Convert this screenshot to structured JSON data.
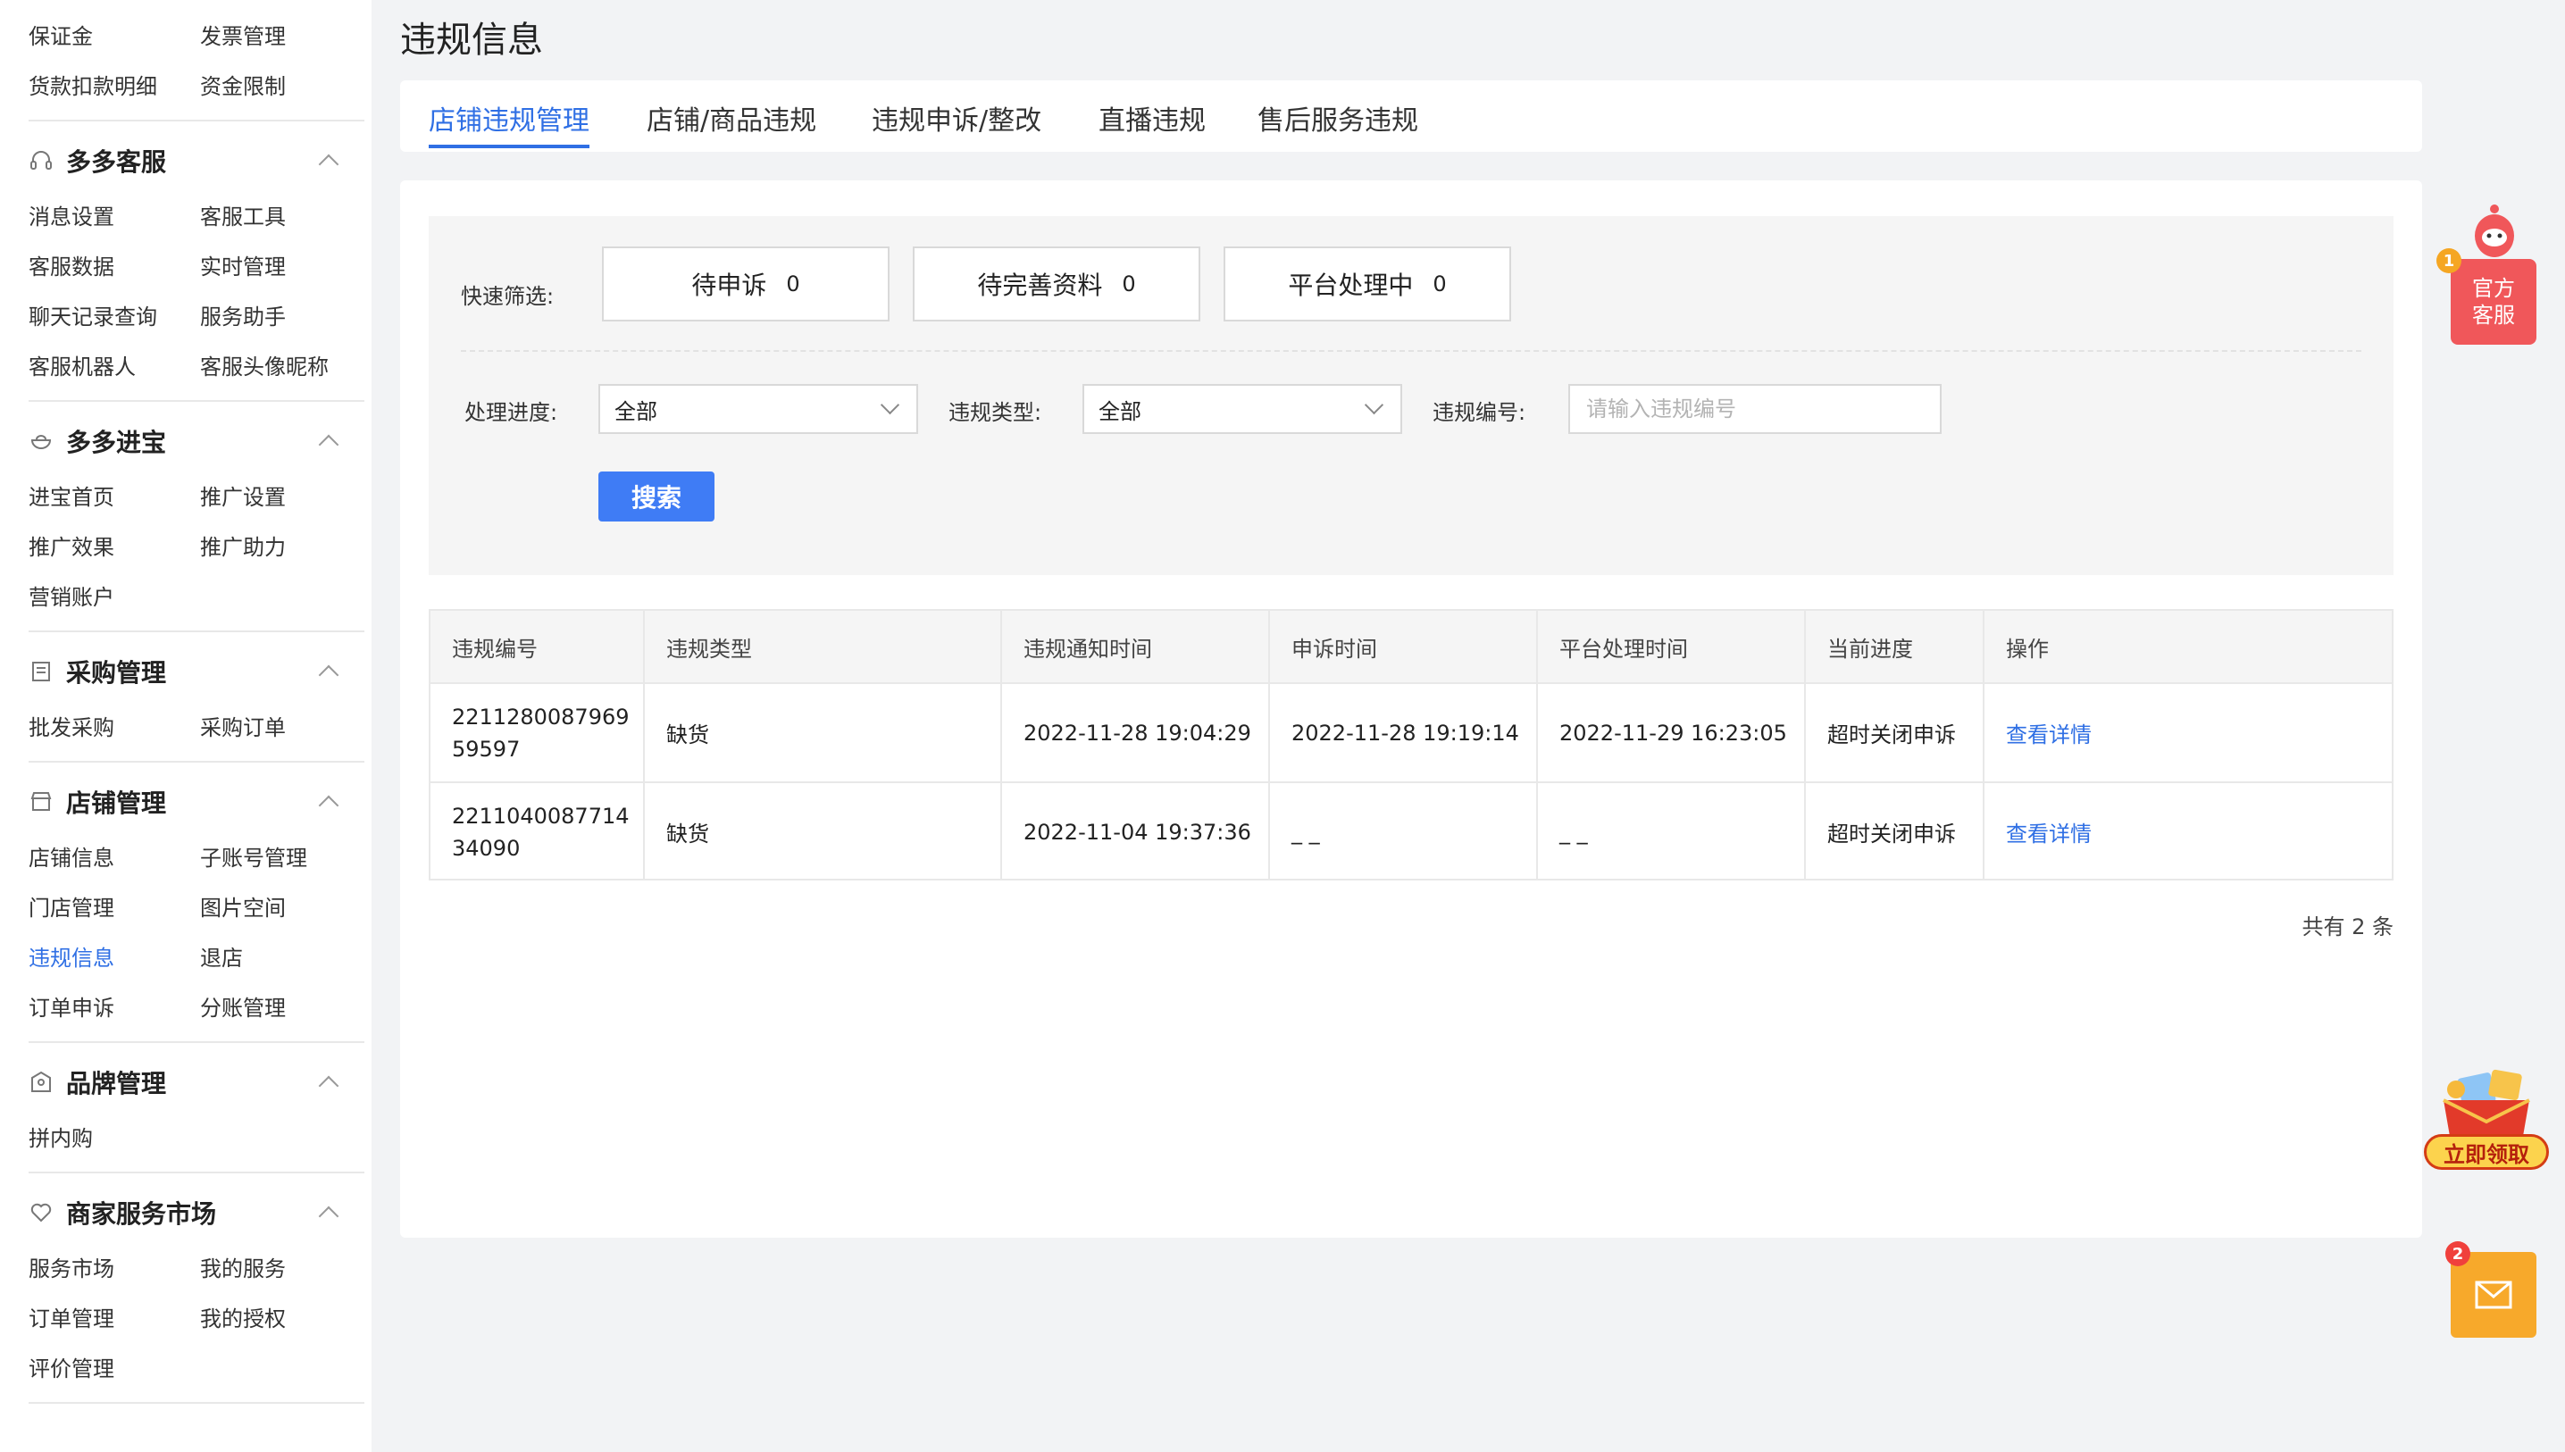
{
  "sidebar": {
    "top_links": [
      [
        "保证金",
        "发票管理"
      ],
      [
        "货款扣款明细",
        "资金限制"
      ]
    ],
    "groups": [
      {
        "title": "多多客服",
        "icon": "headset-icon",
        "links": [
          [
            "消息设置",
            "客服工具"
          ],
          [
            "客服数据",
            "实时管理"
          ],
          [
            "聊天记录查询",
            "服务助手"
          ],
          [
            "客服机器人",
            "客服头像昵称"
          ]
        ]
      },
      {
        "title": "多多进宝",
        "icon": "treasure-bowl-icon",
        "links": [
          [
            "进宝首页",
            "推广设置"
          ],
          [
            "推广效果",
            "推广助力"
          ],
          [
            "营销账户",
            ""
          ]
        ]
      },
      {
        "title": "采购管理",
        "icon": "purchase-list-icon",
        "links": [
          [
            "批发采购",
            "采购订单"
          ]
        ]
      },
      {
        "title": "店铺管理",
        "icon": "store-icon",
        "links": [
          [
            "店铺信息",
            "子账号管理"
          ],
          [
            "门店管理",
            "图片空间"
          ],
          [
            "违规信息",
            "退店"
          ],
          [
            "订单申诉",
            "分账管理"
          ]
        ]
      },
      {
        "title": "品牌管理",
        "icon": "brand-icon",
        "links": [
          [
            "拼内购",
            ""
          ]
        ]
      },
      {
        "title": "商家服务市场",
        "icon": "heart-icon",
        "links": [
          [
            "服务市场",
            "我的服务"
          ],
          [
            "订单管理",
            "我的授权"
          ],
          [
            "评价管理",
            ""
          ]
        ]
      }
    ],
    "active_link": "违规信息"
  },
  "page": {
    "title": "违规信息"
  },
  "tabs": [
    "店铺违规管理",
    "店铺/商品违规",
    "违规申诉/整改",
    "直播违规",
    "售后服务违规"
  ],
  "active_tab": "店铺违规管理",
  "filters": {
    "quick_label": "快速筛选:",
    "quick": [
      {
        "label": "待申诉",
        "count": "0"
      },
      {
        "label": "待完善资料",
        "count": "0"
      },
      {
        "label": "平台处理中",
        "count": "0"
      }
    ],
    "progress_label": "处理进度:",
    "progress_value": "全部",
    "type_label": "违规类型:",
    "type_value": "全部",
    "id_label": "违规编号:",
    "id_placeholder": "请输入违规编号",
    "search_label": "搜索"
  },
  "table": {
    "headers": [
      "违规编号",
      "违规类型",
      "违规通知时间",
      "申诉时间",
      "平台处理时间",
      "当前进度",
      "操作"
    ],
    "rows": [
      [
        "221128008796959597",
        "缺货",
        "2022-11-28 19:04:29",
        "2022-11-28 19:19:14",
        "2022-11-29 16:23:05",
        "超时关闭申诉",
        "查看详情"
      ],
      [
        "221104008771434090",
        "缺货",
        "2022-11-04 19:37:36",
        "_ _",
        "_ _",
        "超时关闭申诉",
        "查看详情"
      ]
    ],
    "total": "共有 2 条"
  },
  "widgets": {
    "cs_label_line1": "官方",
    "cs_label_line2": "客服",
    "cs_badge": "1",
    "promo_label": "立即领取",
    "mail_badge": "2"
  },
  "colors": {
    "accent": "#2f6fe4",
    "button": "#3f7cf5",
    "cs": "#f0575a",
    "mail": "#f7a92b"
  }
}
